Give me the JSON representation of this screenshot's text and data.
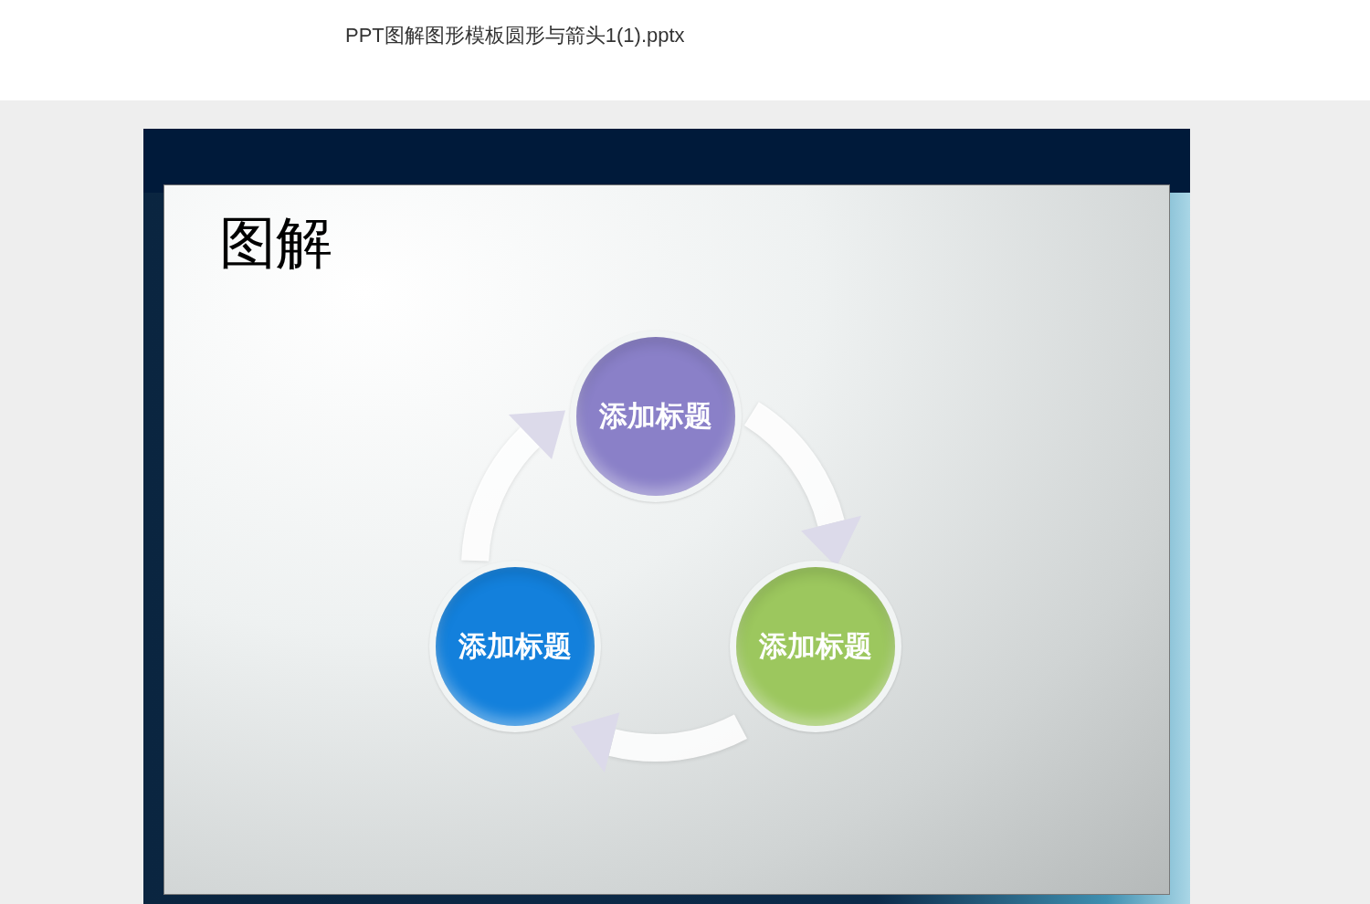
{
  "document": {
    "filename": "PPT图解图形模板圆形与箭头1(1).pptx"
  },
  "slide": {
    "title": "图解",
    "nodes": [
      {
        "label": "添加标题",
        "color": "#8a80c8"
      },
      {
        "label": "添加标题",
        "color": "#9cc75e"
      },
      {
        "label": "添加标题",
        "color": "#1380dc"
      }
    ]
  }
}
